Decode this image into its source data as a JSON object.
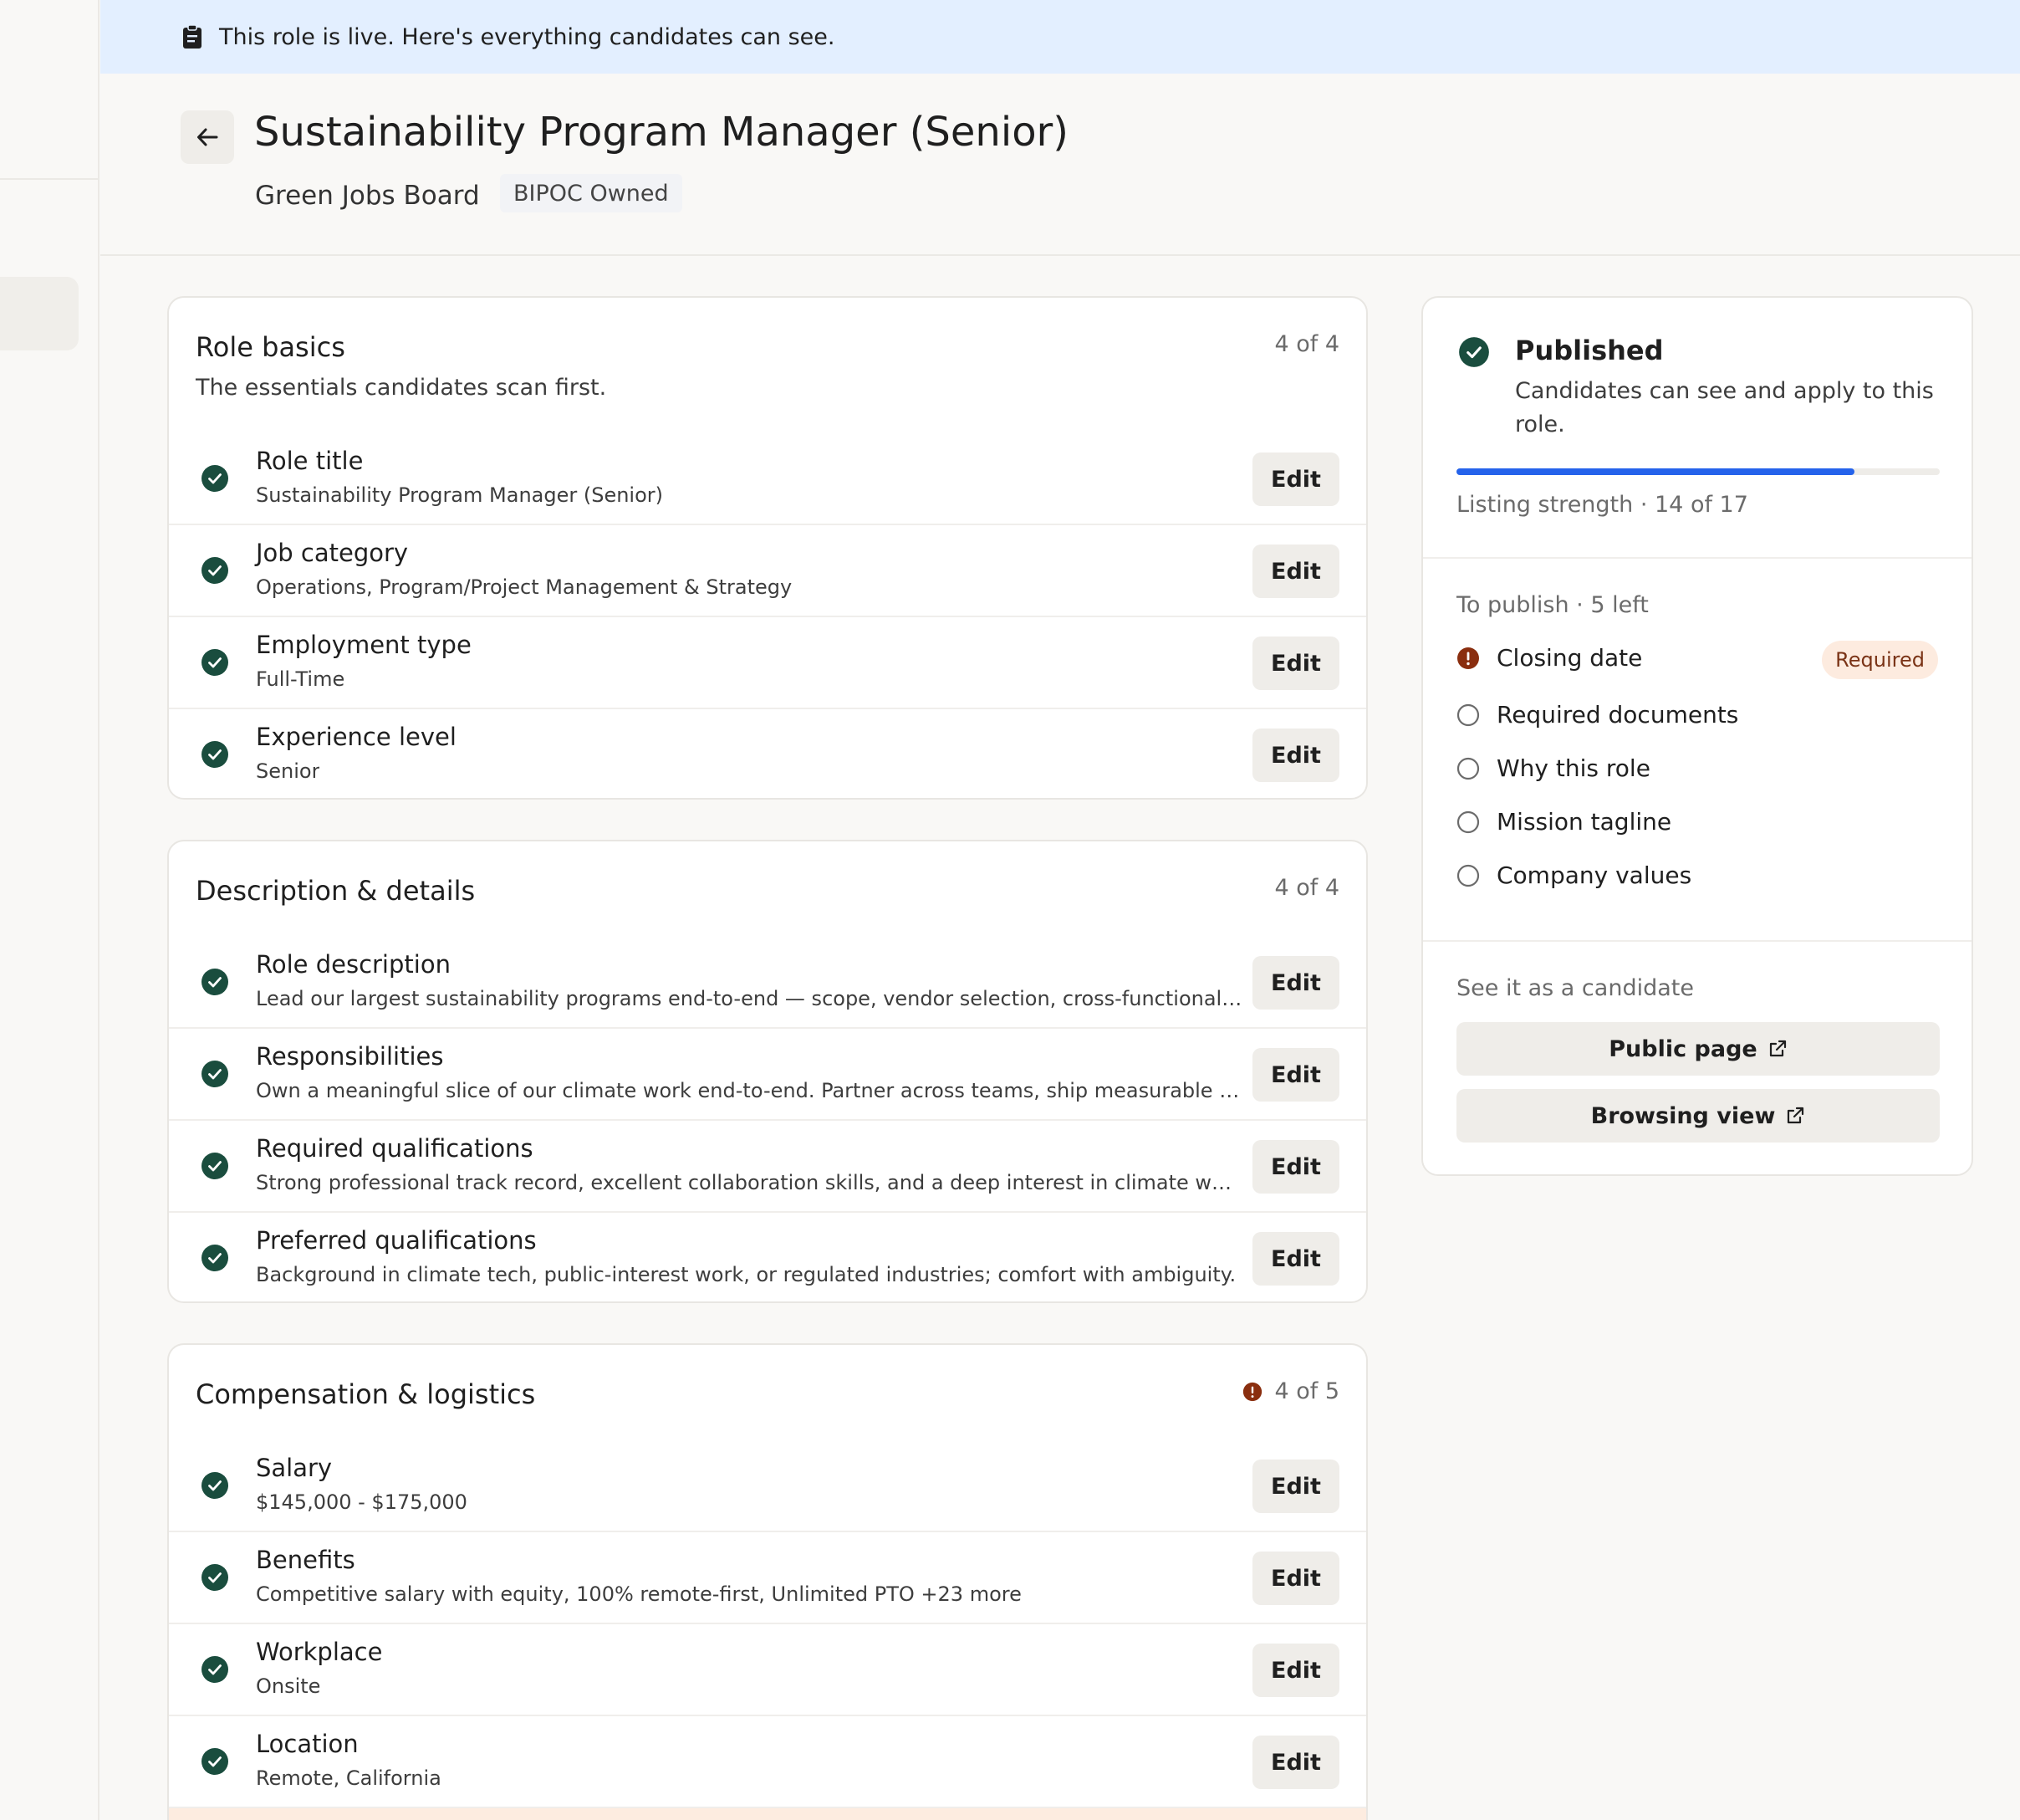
{
  "banner": {
    "text": "This role is live. Here's everything candidates can see."
  },
  "header": {
    "title": "Sustainability Program Manager (Senior)",
    "org": "Green Jobs Board",
    "badge": "BIPOC Owned"
  },
  "colors": {
    "accent_green": "#1a4d3e",
    "progress_blue": "#2563eb",
    "warning": "#8a2e0f"
  },
  "sections": {
    "basics": {
      "title": "Role basics",
      "subtitle": "The essentials candidates scan first.",
      "count": "4 of 4",
      "rows": [
        {
          "label": "Role title",
          "value": "Sustainability Program Manager (Senior)",
          "edit": "Edit"
        },
        {
          "label": "Job category",
          "value": "Operations, Program/Project Management & Strategy",
          "edit": "Edit"
        },
        {
          "label": "Employment type",
          "value": "Full-Time",
          "edit": "Edit"
        },
        {
          "label": "Experience level",
          "value": "Senior",
          "edit": "Edit"
        }
      ]
    },
    "description": {
      "title": "Description & details",
      "count": "4 of 4",
      "rows": [
        {
          "label": "Role description",
          "value": "Lead our largest sustainability programs end-to-end — scope, vendor selection, cross-functional…",
          "edit": "Edit"
        },
        {
          "label": "Responsibilities",
          "value": "Own a meaningful slice of our climate work end-to-end. Partner across teams, ship measurable impact…",
          "edit": "Edit"
        },
        {
          "label": "Required qualifications",
          "value": "Strong professional track record, excellent collaboration skills, and a deep interest in climate work.",
          "edit": "Edit"
        },
        {
          "label": "Preferred qualifications",
          "value": "Background in climate tech, public-interest work, or regulated industries; comfort with ambiguity.",
          "edit": "Edit"
        }
      ]
    },
    "compensation": {
      "title": "Compensation & logistics",
      "count": "4 of 5",
      "rows": [
        {
          "label": "Salary",
          "value": "$145,000 - $175,000",
          "edit": "Edit"
        },
        {
          "label": "Benefits",
          "value": "Competitive salary with equity, 100% remote-first, Unlimited PTO +23 more",
          "edit": "Edit"
        },
        {
          "label": "Workplace",
          "value": "Onsite",
          "edit": "Edit"
        },
        {
          "label": "Location",
          "value": "Remote, California",
          "edit": "Edit"
        }
      ]
    }
  },
  "status": {
    "title": "Published",
    "description": "Candidates can see and apply to this role.",
    "strength_label": "Listing strength · 14 of 17",
    "strength_fraction": 0.824,
    "todo_header": "To publish · 5 left",
    "todos": [
      {
        "label": "Closing date",
        "state": "required"
      },
      {
        "label": "Required documents",
        "state": "open"
      },
      {
        "label": "Why this role",
        "state": "open"
      },
      {
        "label": "Mission tagline",
        "state": "open"
      },
      {
        "label": "Company values",
        "state": "open"
      }
    ],
    "required_badge": "Required",
    "see_header": "See it as a candidate",
    "public_page": "Public page",
    "browsing_view": "Browsing view"
  }
}
